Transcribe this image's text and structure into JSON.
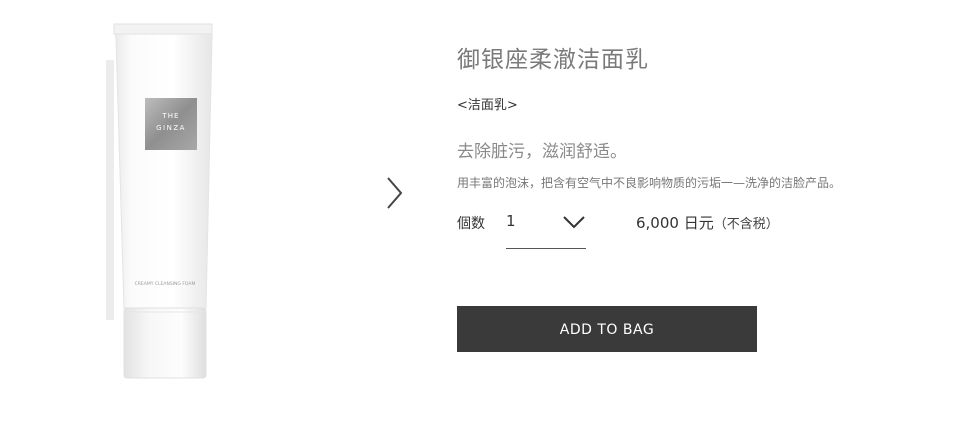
{
  "product": {
    "title": "御银座柔澈洁面乳",
    "category": "<洁面乳>",
    "tagline": "去除脏污，滋润舒适。",
    "description": "用丰富的泡沫，把含有空气中不良影响物质的污垢一—洗净的洁脸产品。",
    "image": {
      "logo_line1": "THE",
      "logo_line2": "GINZA",
      "tube_text": "CREAMY CLEANSING FOAM"
    }
  },
  "purchase": {
    "qty_label": "個数",
    "qty_value": "1",
    "price": "6,000 日元",
    "tax_note": "（不含税）",
    "add_to_bag_label": "ADD TO BAG"
  },
  "colors": {
    "button_bg": "#3a3a3a",
    "title_gray": "#7a7a7a"
  },
  "icons": {
    "next": "chevron-right-icon",
    "dropdown": "chevron-down-icon"
  }
}
